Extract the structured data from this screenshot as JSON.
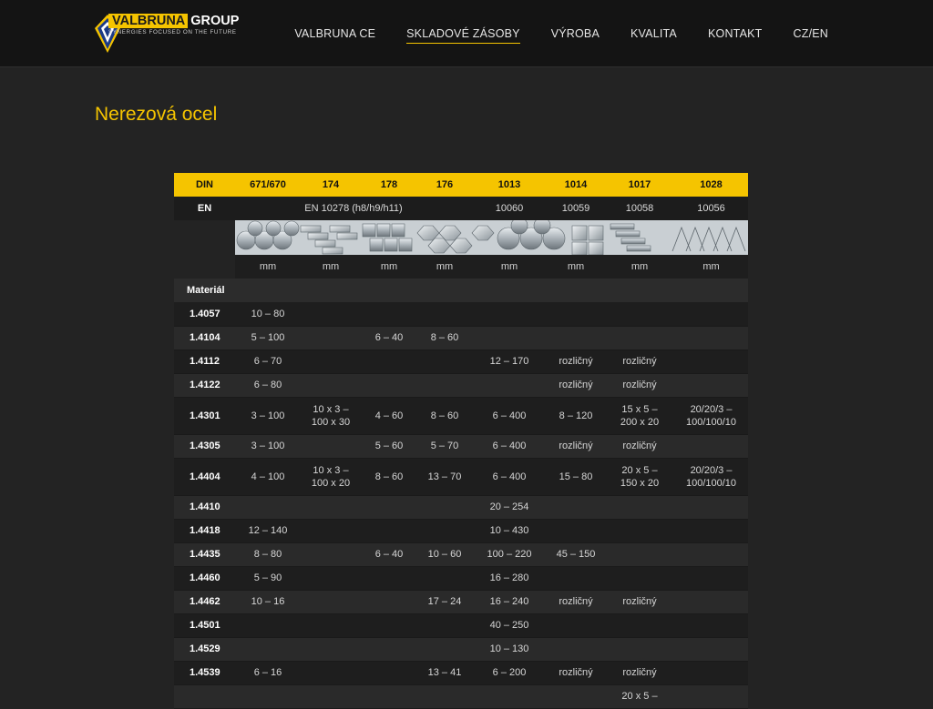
{
  "header": {
    "logo": {
      "brand_main": "VALBRUNA",
      "brand_group": "GROUP",
      "tagline": "SYNERGIES FOCUSED ON THE FUTURE"
    },
    "nav": [
      {
        "label": "VALBRUNA CE"
      },
      {
        "label": "SKLADOVÉ ZÁSOBY"
      },
      {
        "label": "VÝROBA"
      },
      {
        "label": "KVALITA"
      },
      {
        "label": "KONTAKT"
      },
      {
        "label": "CZ/EN"
      }
    ],
    "active_index": 1
  },
  "page": {
    "title": "Nerezová ocel"
  },
  "colors": {
    "accent": "#f5c400",
    "background": "#232323",
    "header": "#141414"
  },
  "table": {
    "din_label": "DIN",
    "din": [
      "671/670",
      "174",
      "178",
      "176",
      "1013",
      "1014",
      "1017",
      "1028"
    ],
    "en_label": "EN",
    "en_norm": "EN 10278 (h8/h9/h11)",
    "en": [
      "10060",
      "10059",
      "10058",
      "10056"
    ],
    "unit": "mm",
    "material_label": "Materiál",
    "rows": [
      {
        "m": "1.4057",
        "v": [
          "10 – 80",
          "",
          "",
          "",
          "",
          "",
          "",
          ""
        ]
      },
      {
        "m": "1.4104",
        "v": [
          "5 – 100",
          "",
          "6 – 40",
          "8 – 60",
          "",
          "",
          "",
          ""
        ]
      },
      {
        "m": "1.4112",
        "v": [
          "6 – 70",
          "",
          "",
          "",
          "12 – 170",
          "rozličný",
          "rozličný",
          ""
        ]
      },
      {
        "m": "1.4122",
        "v": [
          "6 – 80",
          "",
          "",
          "",
          "",
          "rozličný",
          "rozličný",
          ""
        ]
      },
      {
        "m": "1.4301",
        "v": [
          "3 – 100",
          "10 x 3 –\n100 x 30",
          "4 – 60",
          "8 – 60",
          "6 – 400",
          "8 – 120",
          "15 x 5 –\n200 x 20",
          "20/20/3 –\n100/100/10"
        ]
      },
      {
        "m": "1.4305",
        "v": [
          "3 – 100",
          "",
          "5 – 60",
          "5 – 70",
          "6 – 400",
          "rozličný",
          "rozličný",
          ""
        ]
      },
      {
        "m": "1.4404",
        "v": [
          "4 – 100",
          "10 x 3 –\n100 x 20",
          "8 – 60",
          "13 – 70",
          "6 – 400",
          "15 – 80",
          "20 x 5 –\n150 x 20",
          "20/20/3 –\n100/100/10"
        ]
      },
      {
        "m": "1.4410",
        "v": [
          "",
          "",
          "",
          "",
          "20 – 254",
          "",
          "",
          ""
        ]
      },
      {
        "m": "1.4418",
        "v": [
          "12 – 140",
          "",
          "",
          "",
          "10 – 430",
          "",
          "",
          ""
        ]
      },
      {
        "m": "1.4435",
        "v": [
          "8 – 80",
          "",
          "6 – 40",
          "10 – 60",
          "100 – 220",
          "45 – 150",
          "",
          ""
        ]
      },
      {
        "m": "1.4460",
        "v": [
          "5 – 90",
          "",
          "",
          "",
          "16 – 280",
          "",
          "",
          ""
        ]
      },
      {
        "m": "1.4462",
        "v": [
          "10 – 16",
          "",
          "",
          "17 – 24",
          "16 – 240",
          "rozličný",
          "rozličný",
          ""
        ]
      },
      {
        "m": "1.4501",
        "v": [
          "",
          "",
          "",
          "",
          "40 – 250",
          "",
          "",
          ""
        ]
      },
      {
        "m": "1.4529",
        "v": [
          "",
          "",
          "",
          "",
          "10 – 130",
          "",
          "",
          ""
        ]
      },
      {
        "m": "1.4539",
        "v": [
          "6 – 16",
          "",
          "",
          "13 – 41",
          "6 – 200",
          "rozličný",
          "rozličný",
          ""
        ]
      },
      {
        "m": "",
        "v": [
          "",
          "",
          "",
          "",
          "",
          "",
          "20 x 5 –",
          ""
        ]
      }
    ]
  }
}
